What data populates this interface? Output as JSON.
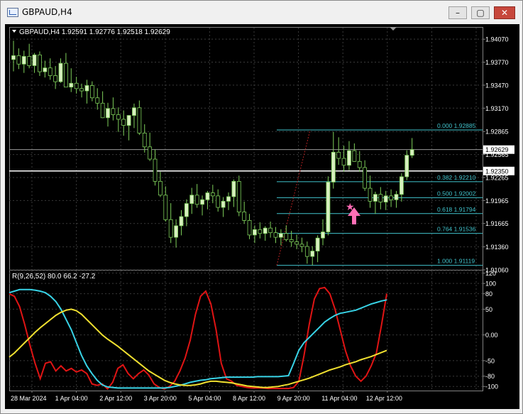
{
  "window": {
    "title": "GBPAUD,H4",
    "buttons": {
      "minimize": "–",
      "maximize": "▢",
      "close": "✕"
    }
  },
  "colors": {
    "background": "#000000",
    "grid": "#3a3a3a",
    "axis_text": "#ffffff",
    "bull_candle": "#d8f0c0",
    "bear_candle": "#000000",
    "candle_wick": "#7ecf5a",
    "fib": "#41c3cc",
    "horizontal_line": "#ffffff",
    "signal_star": "#ff69b4",
    "signal_arrow": "#ff6fb5",
    "ind_red": "#e01414",
    "ind_cyan": "#38d3e6",
    "ind_yellow": "#f0e030"
  },
  "icons": [
    "app-chart-icon",
    "dropdown-triangle-icon",
    "scroll-marker-icon",
    "star-icon",
    "arrow-up-icon"
  ],
  "ohlc_header": "GBPAUD,H4  1.92591 1.92776 1.92518 1.92629",
  "price_axis": {
    "ticks": [
      "1.94070",
      "1.93770",
      "1.93470",
      "1.93170",
      "1.92865",
      "1.92565",
      "1.92265",
      "1.91965",
      "1.91665",
      "1.91360",
      "1.91060"
    ],
    "current_price": "1.92629",
    "line_price": "1.92350"
  },
  "fibonacci": {
    "levels": [
      {
        "label": "0.000  1.92885",
        "price": 1.92885
      },
      {
        "label": "0.382  1.92210",
        "price": 1.9221
      },
      {
        "label": "0.500  1.92002",
        "price": 1.92002
      },
      {
        "label": "0.618  1.91794",
        "price": 1.91794
      },
      {
        "label": "0.764  1.91536",
        "price": 1.91536
      },
      {
        "label": "1.000  1.91119",
        "price": 1.91119
      }
    ]
  },
  "indicator": {
    "label": "R(9,26,52) 80.0 66.2 -27.2",
    "ticks": [
      "120",
      "100",
      "80",
      "50",
      "0.00",
      "-50",
      "-80",
      "-100"
    ]
  },
  "time_axis": {
    "labels": [
      "28 Mar 2024",
      "1 Apr 04:00",
      "2 Apr 12:00",
      "3 Apr 20:00",
      "5 Apr 04:00",
      "8 Apr 12:00",
      "9 Apr 20:00",
      "11 Apr 04:00",
      "12 Apr 12:00"
    ]
  },
  "chart_data": {
    "type": "candlestick",
    "symbol": "GBPAUD",
    "timeframe": "H4",
    "ylim": [
      1.9106,
      1.9422
    ],
    "candles": [
      {
        "o": 1.93805,
        "h": 1.9405,
        "l": 1.9365,
        "c": 1.93855
      },
      {
        "o": 1.93855,
        "h": 1.9395,
        "l": 1.9368,
        "c": 1.93745
      },
      {
        "o": 1.93745,
        "h": 1.9392,
        "l": 1.9363,
        "c": 1.93845
      },
      {
        "o": 1.93845,
        "h": 1.9401,
        "l": 1.9369,
        "c": 1.93725
      },
      {
        "o": 1.93725,
        "h": 1.9389,
        "l": 1.9363,
        "c": 1.93865
      },
      {
        "o": 1.93865,
        "h": 1.9391,
        "l": 1.9359,
        "c": 1.93645
      },
      {
        "o": 1.93645,
        "h": 1.9379,
        "l": 1.9357,
        "c": 1.93695
      },
      {
        "o": 1.93695,
        "h": 1.9382,
        "l": 1.9354,
        "c": 1.93595
      },
      {
        "o": 1.93595,
        "h": 1.9372,
        "l": 1.9342,
        "c": 1.93515
      },
      {
        "o": 1.93515,
        "h": 1.9382,
        "l": 1.935,
        "c": 1.93755
      },
      {
        "o": 1.93755,
        "h": 1.9389,
        "l": 1.9354,
        "c": 1.93445
      },
      {
        "o": 1.93445,
        "h": 1.9369,
        "l": 1.9338,
        "c": 1.93495
      },
      {
        "o": 1.93495,
        "h": 1.9358,
        "l": 1.9336,
        "c": 1.93425
      },
      {
        "o": 1.93425,
        "h": 1.9349,
        "l": 1.9331,
        "c": 1.93395
      },
      {
        "o": 1.93395,
        "h": 1.9354,
        "l": 1.9323,
        "c": 1.93465
      },
      {
        "o": 1.93465,
        "h": 1.9352,
        "l": 1.9326,
        "c": 1.93305
      },
      {
        "o": 1.93305,
        "h": 1.9343,
        "l": 1.9315,
        "c": 1.93235
      },
      {
        "o": 1.93235,
        "h": 1.9339,
        "l": 1.9304,
        "c": 1.93045
      },
      {
        "o": 1.93045,
        "h": 1.9324,
        "l": 1.9293,
        "c": 1.93165
      },
      {
        "o": 1.93165,
        "h": 1.9331,
        "l": 1.9301,
        "c": 1.93085
      },
      {
        "o": 1.93085,
        "h": 1.9318,
        "l": 1.9286,
        "c": 1.93025
      },
      {
        "o": 1.93025,
        "h": 1.9314,
        "l": 1.9281,
        "c": 1.92945
      },
      {
        "o": 1.92945,
        "h": 1.9308,
        "l": 1.9275,
        "c": 1.93075
      },
      {
        "o": 1.93075,
        "h": 1.9323,
        "l": 1.9291,
        "c": 1.93175
      },
      {
        "o": 1.93175,
        "h": 1.9327,
        "l": 1.9282,
        "c": 1.92845
      },
      {
        "o": 1.92845,
        "h": 1.9296,
        "l": 1.9259,
        "c": 1.92665
      },
      {
        "o": 1.92665,
        "h": 1.9285,
        "l": 1.9248,
        "c": 1.92505
      },
      {
        "o": 1.92505,
        "h": 1.9263,
        "l": 1.9216,
        "c": 1.92215
      },
      {
        "o": 1.92215,
        "h": 1.9234,
        "l": 1.9201,
        "c": 1.92035
      },
      {
        "o": 1.92035,
        "h": 1.9215,
        "l": 1.9169,
        "c": 1.91715
      },
      {
        "o": 1.91715,
        "h": 1.9193,
        "l": 1.9141,
        "c": 1.91485
      },
      {
        "o": 1.91485,
        "h": 1.9172,
        "l": 1.9135,
        "c": 1.91635
      },
      {
        "o": 1.91635,
        "h": 1.9184,
        "l": 1.9151,
        "c": 1.91755
      },
      {
        "o": 1.91755,
        "h": 1.9198,
        "l": 1.9163,
        "c": 1.91925
      },
      {
        "o": 1.91925,
        "h": 1.9213,
        "l": 1.9179,
        "c": 1.92035
      },
      {
        "o": 1.92035,
        "h": 1.9218,
        "l": 1.9187,
        "c": 1.91915
      },
      {
        "o": 1.91915,
        "h": 1.9203,
        "l": 1.9177,
        "c": 1.91975
      },
      {
        "o": 1.91975,
        "h": 1.9209,
        "l": 1.9185,
        "c": 1.92065
      },
      {
        "o": 1.92065,
        "h": 1.9217,
        "l": 1.9193,
        "c": 1.92025
      },
      {
        "o": 1.92025,
        "h": 1.9211,
        "l": 1.9182,
        "c": 1.91875
      },
      {
        "o": 1.91875,
        "h": 1.9201,
        "l": 1.9175,
        "c": 1.91955
      },
      {
        "o": 1.91955,
        "h": 1.9207,
        "l": 1.9184,
        "c": 1.92015
      },
      {
        "o": 1.92015,
        "h": 1.9224,
        "l": 1.9188,
        "c": 1.92215
      },
      {
        "o": 1.92215,
        "h": 1.9229,
        "l": 1.9176,
        "c": 1.91815
      },
      {
        "o": 1.91815,
        "h": 1.9195,
        "l": 1.9166,
        "c": 1.91705
      },
      {
        "o": 1.91705,
        "h": 1.9179,
        "l": 1.9146,
        "c": 1.91515
      },
      {
        "o": 1.91515,
        "h": 1.9164,
        "l": 1.9141,
        "c": 1.91585
      },
      {
        "o": 1.91585,
        "h": 1.9168,
        "l": 1.9147,
        "c": 1.91535
      },
      {
        "o": 1.91535,
        "h": 1.9163,
        "l": 1.9144,
        "c": 1.91605
      },
      {
        "o": 1.91605,
        "h": 1.9169,
        "l": 1.9148,
        "c": 1.91545
      },
      {
        "o": 1.91545,
        "h": 1.9162,
        "l": 1.9141,
        "c": 1.91485
      },
      {
        "o": 1.91485,
        "h": 1.9159,
        "l": 1.9138,
        "c": 1.91535
      },
      {
        "o": 1.91535,
        "h": 1.9164,
        "l": 1.9143,
        "c": 1.91455
      },
      {
        "o": 1.91455,
        "h": 1.9157,
        "l": 1.9136,
        "c": 1.91425
      },
      {
        "o": 1.91425,
        "h": 1.9152,
        "l": 1.9133,
        "c": 1.91395
      },
      {
        "o": 1.91395,
        "h": 1.9148,
        "l": 1.9129,
        "c": 1.91365
      },
      {
        "o": 1.91365,
        "h": 1.9143,
        "l": 1.9114,
        "c": 1.91235
      },
      {
        "o": 1.91235,
        "h": 1.9137,
        "l": 1.9112,
        "c": 1.91305
      },
      {
        "o": 1.91305,
        "h": 1.9151,
        "l": 1.9116,
        "c": 1.91475
      },
      {
        "o": 1.91475,
        "h": 1.9172,
        "l": 1.9138,
        "c": 1.91555
      },
      {
        "o": 1.91555,
        "h": 1.9228,
        "l": 1.9151,
        "c": 1.92205
      },
      {
        "o": 1.92205,
        "h": 1.9286,
        "l": 1.9212,
        "c": 1.92595
      },
      {
        "o": 1.92595,
        "h": 1.9279,
        "l": 1.9243,
        "c": 1.92515
      },
      {
        "o": 1.92515,
        "h": 1.9268,
        "l": 1.9234,
        "c": 1.92425
      },
      {
        "o": 1.92425,
        "h": 1.9274,
        "l": 1.9236,
        "c": 1.92615
      },
      {
        "o": 1.92615,
        "h": 1.9271,
        "l": 1.9247,
        "c": 1.92475
      },
      {
        "o": 1.92475,
        "h": 1.9261,
        "l": 1.9234,
        "c": 1.92395
      },
      {
        "o": 1.92395,
        "h": 1.9249,
        "l": 1.9209,
        "c": 1.92125
      },
      {
        "o": 1.92125,
        "h": 1.9229,
        "l": 1.9187,
        "c": 1.91955
      },
      {
        "o": 1.91955,
        "h": 1.9208,
        "l": 1.9179,
        "c": 1.92045
      },
      {
        "o": 1.92045,
        "h": 1.9214,
        "l": 1.9185,
        "c": 1.91945
      },
      {
        "o": 1.91945,
        "h": 1.9209,
        "l": 1.9184,
        "c": 1.92025
      },
      {
        "o": 1.92025,
        "h": 1.9211,
        "l": 1.9188,
        "c": 1.91975
      },
      {
        "o": 1.91975,
        "h": 1.9209,
        "l": 1.9187,
        "c": 1.92045
      },
      {
        "o": 1.92045,
        "h": 1.9232,
        "l": 1.9195,
        "c": 1.92275
      },
      {
        "o": 1.92275,
        "h": 1.9262,
        "l": 1.9223,
        "c": 1.92555
      },
      {
        "o": 1.92555,
        "h": 1.9278,
        "l": 1.9252,
        "c": 1.92629
      }
    ],
    "indicator": {
      "name": "R(9,26,52)",
      "ylim": [
        -108,
        125
      ],
      "series": [
        {
          "color": "red",
          "values": [
            80,
            75,
            55,
            20,
            -20,
            -55,
            -85,
            -55,
            -52,
            -70,
            -60,
            -70,
            -65,
            -72,
            -68,
            -75,
            -95,
            -98,
            -95,
            -105,
            -92,
            -65,
            -58,
            -75,
            -85,
            -75,
            -68,
            -78,
            -95,
            -102,
            -105,
            -100,
            -90,
            -70,
            -45,
            -10,
            40,
            75,
            85,
            60,
            10,
            -55,
            -85,
            -90,
            -98,
            -100,
            -102,
            -103,
            -103,
            -103,
            -104,
            -104,
            -104,
            -104,
            -104,
            -102,
            -90,
            -40,
            20,
            70,
            90,
            92,
            80,
            50,
            10,
            -30,
            -60,
            -80,
            -90,
            -80,
            -60,
            -35,
            20,
            80
          ]
        },
        {
          "color": "cyan",
          "values": [
            82,
            85,
            88,
            88,
            88,
            87,
            85,
            82,
            75,
            65,
            50,
            30,
            10,
            -15,
            -40,
            -60,
            -75,
            -88,
            -97,
            -101,
            -102,
            -103,
            -103,
            -103,
            -103,
            -103,
            -103,
            -103,
            -103,
            -103,
            -103,
            -102,
            -100,
            -98,
            -95,
            -92,
            -90,
            -88,
            -87,
            -85,
            -84,
            -83,
            -82,
            -82,
            -82,
            -82,
            -82,
            -82,
            -81,
            -81,
            -81,
            -81,
            -81,
            -80,
            -79,
            -55,
            -30,
            -15,
            -5,
            5,
            15,
            25,
            32,
            38,
            42,
            44,
            46,
            48,
            52,
            56,
            60,
            63,
            66,
            68
          ]
        },
        {
          "color": "yellow",
          "values": [
            -43,
            -35,
            -25,
            -15,
            -5,
            5,
            14,
            22,
            30,
            38,
            44,
            48,
            50,
            47,
            40,
            30,
            20,
            10,
            0,
            -8,
            -15,
            -22,
            -30,
            -38,
            -46,
            -54,
            -62,
            -70,
            -76,
            -82,
            -88,
            -92,
            -95,
            -97,
            -98,
            -98,
            -97,
            -95,
            -92,
            -90,
            -90,
            -91,
            -92,
            -93,
            -95,
            -97,
            -99,
            -100,
            -101,
            -102,
            -102,
            -101,
            -100,
            -98,
            -96,
            -93,
            -90,
            -87,
            -84,
            -80,
            -76,
            -72,
            -68,
            -65,
            -62,
            -58,
            -55,
            -52,
            -48,
            -45,
            -42,
            -38,
            -34,
            -30
          ]
        }
      ]
    }
  }
}
